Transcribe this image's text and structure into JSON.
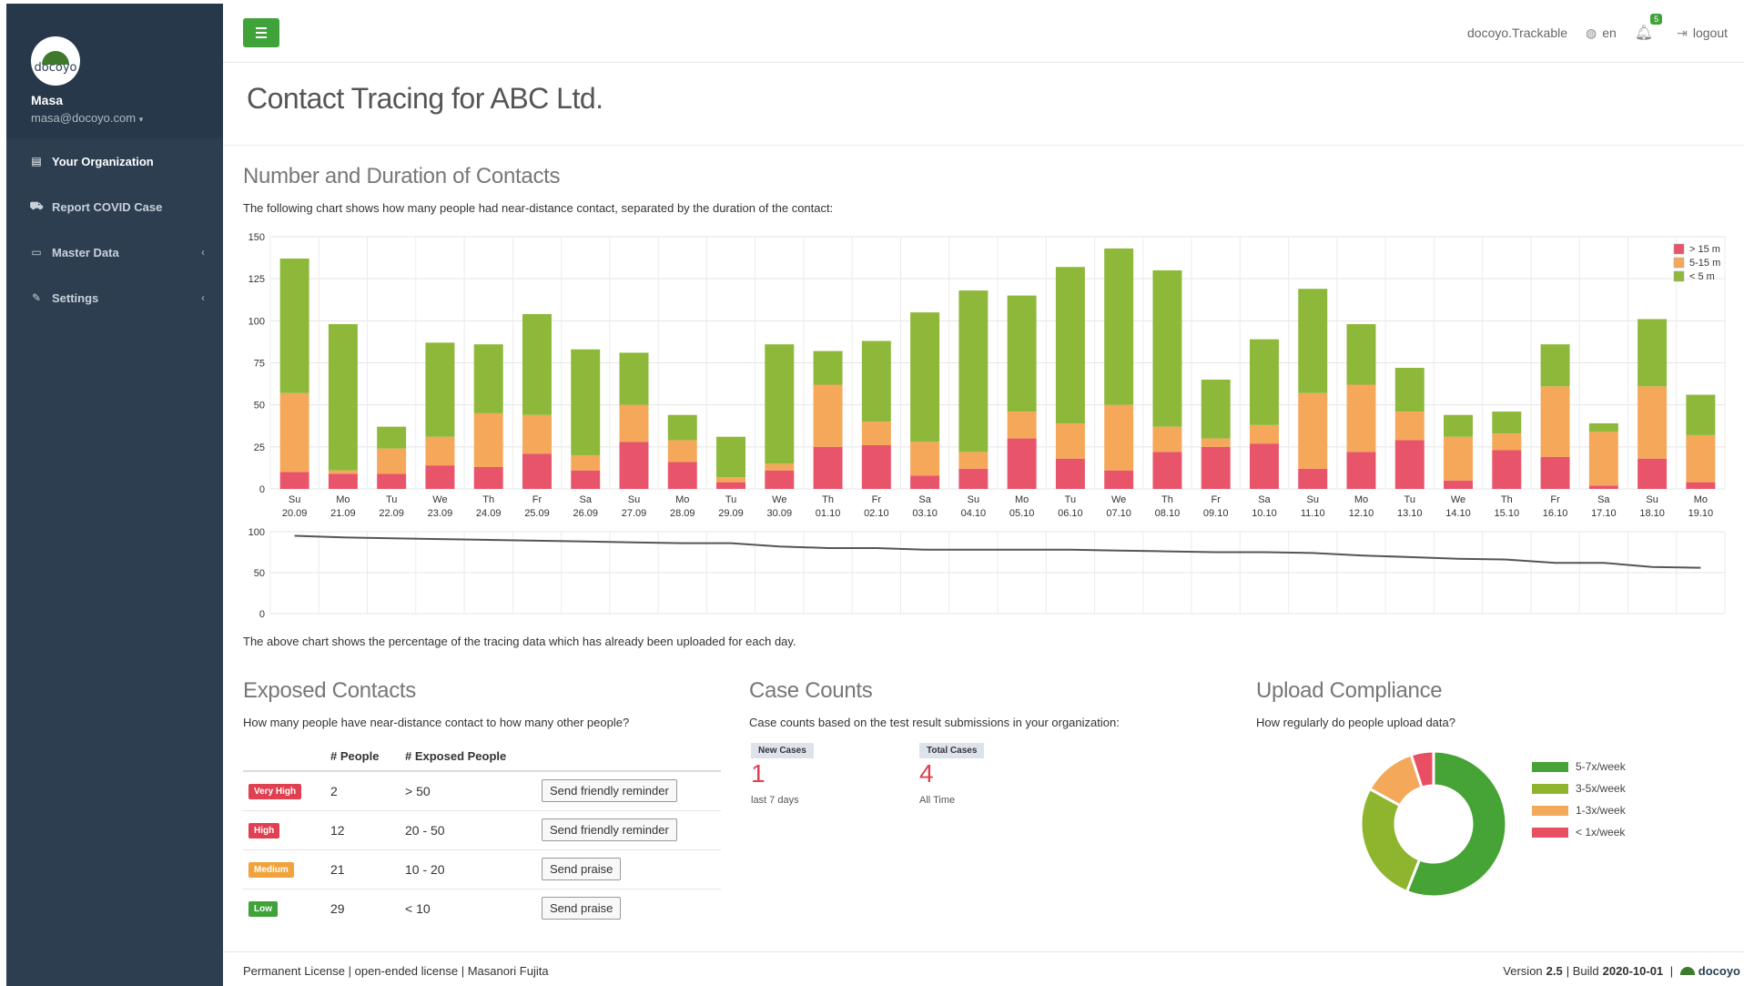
{
  "sidebar": {
    "logo_text": "docoyo",
    "user_name": "Masa",
    "user_email": "masa@docoyo.com",
    "items": [
      {
        "label": "Your Organization",
        "icon": "building-icon",
        "active": true
      },
      {
        "label": "Report COVID Case",
        "icon": "ambulance-icon"
      },
      {
        "label": "Master Data",
        "icon": "folder-icon",
        "has_submenu": true
      },
      {
        "label": "Settings",
        "icon": "wrench-icon",
        "has_submenu": true
      }
    ]
  },
  "topbar": {
    "app_name": "docoyo.Trackable",
    "language": "en",
    "notification_count": "5",
    "logout_label": "logout",
    "accent": "#3fa33a"
  },
  "page": {
    "title": "Contact Tracing for ABC Ltd."
  },
  "contacts": {
    "title": "Number and Duration of Contacts",
    "description": "The following chart shows how many people had near-distance contact, separated by the duration of the contact:",
    "upload_note": "The above chart shows the percentage of the tracing data which has already been uploaded for each day."
  },
  "chart_data": [
    {
      "type": "bar",
      "stacked": true,
      "categories": [
        "Su 20.09",
        "Mo 21.09",
        "Tu 22.09",
        "We 23.09",
        "Th 24.09",
        "Fr 25.09",
        "Sa 26.09",
        "Su 27.09",
        "Mo 28.09",
        "Tu 29.09",
        "We 30.09",
        "Th 01.10",
        "Fr 02.10",
        "Sa 03.10",
        "Su 04.10",
        "Mo 05.10",
        "Tu 06.10",
        "We 07.10",
        "Th 08.10",
        "Fr 09.10",
        "Sa 10.10",
        "Su 11.10",
        "Mo 12.10",
        "Tu 13.10",
        "We 14.10",
        "Th 15.10",
        "Fr 16.10",
        "Sa 17.10",
        "Su 18.10",
        "Mo 19.10"
      ],
      "series": [
        {
          "name": "> 15 m",
          "color": "#e8546a",
          "values": [
            10,
            9,
            9,
            14,
            13,
            21,
            11,
            28,
            16,
            4,
            11,
            25,
            26,
            8,
            12,
            30,
            18,
            11,
            22,
            25,
            27,
            12,
            22,
            29,
            5,
            23,
            19,
            2,
            18,
            4
          ]
        },
        {
          "name": "5-15 m",
          "color": "#f5a85a",
          "values": [
            47,
            2,
            15,
            17,
            32,
            23,
            9,
            22,
            13,
            3,
            4,
            37,
            14,
            20,
            10,
            16,
            21,
            39,
            15,
            5,
            11,
            45,
            40,
            17,
            26,
            10,
            42,
            32,
            43,
            28
          ]
        },
        {
          "name": "< 5 m",
          "color": "#8db83a",
          "values": [
            80,
            87,
            13,
            56,
            41,
            60,
            63,
            31,
            15,
            24,
            71,
            20,
            48,
            77,
            96,
            69,
            93,
            93,
            93,
            35,
            51,
            62,
            36,
            26,
            13,
            13,
            25,
            5,
            40,
            24
          ]
        }
      ],
      "ylim": [
        0,
        150
      ],
      "yticks": [
        0,
        25,
        50,
        75,
        100,
        125,
        150
      ],
      "legend": "top-right",
      "grid": true
    },
    {
      "type": "line",
      "x": [
        "20.09",
        "21.09",
        "22.09",
        "23.09",
        "24.09",
        "25.09",
        "26.09",
        "27.09",
        "28.09",
        "29.09",
        "30.09",
        "01.10",
        "02.10",
        "03.10",
        "04.10",
        "05.10",
        "06.10",
        "07.10",
        "08.10",
        "09.10",
        "10.10",
        "11.10",
        "12.10",
        "13.10",
        "14.10",
        "15.10",
        "16.10",
        "17.10",
        "18.10",
        "19.10"
      ],
      "series": [
        {
          "color": "#555555",
          "values": [
            95,
            93,
            92,
            91,
            90,
            89,
            88,
            87,
            86,
            86,
            82,
            80,
            80,
            78,
            78,
            78,
            78,
            77,
            76,
            75,
            75,
            74,
            71,
            69,
            67,
            66,
            62,
            62,
            57,
            56
          ]
        }
      ],
      "ylim": [
        0,
        100
      ],
      "yticks": [
        0,
        50,
        100
      ],
      "grid": true
    },
    {
      "type": "pie",
      "donut": true,
      "categories": [
        "5-7x/week",
        "3-5x/week",
        "1-3x/week",
        "< 1x/week"
      ],
      "values": [
        56,
        27,
        12,
        5
      ],
      "colors": [
        "#46a335",
        "#8fb52e",
        "#f4a85a",
        "#e84f63"
      ],
      "legend": "right"
    }
  ],
  "exposed": {
    "title": "Exposed Contacts",
    "description": "How many people have near-distance contact to how many other people?",
    "col_people": "# People",
    "col_exposed": "# Exposed People",
    "rows": [
      {
        "level": "Very High",
        "color": "#e0404f",
        "people": "2",
        "exposed": "> 50",
        "action": "Send friendly reminder"
      },
      {
        "level": "High",
        "color": "#e0404f",
        "people": "12",
        "exposed": "20 - 50",
        "action": "Send friendly reminder"
      },
      {
        "level": "Medium",
        "color": "#f0a23c",
        "people": "21",
        "exposed": "10 - 20",
        "action": "Send praise"
      },
      {
        "level": "Low",
        "color": "#3fa33a",
        "people": "29",
        "exposed": "< 10",
        "action": "Send praise"
      }
    ]
  },
  "cases": {
    "title": "Case Counts",
    "description": "Case counts based on the test result submissions in your organization:",
    "new_label": "New Cases",
    "new_value": "1",
    "new_sub": "last 7 days",
    "total_label": "Total Cases",
    "total_value": "4",
    "total_sub": "All Time"
  },
  "compliance": {
    "title": "Upload Compliance",
    "description": "How regularly do people upload data?"
  },
  "footer": {
    "license": "Permanent License | open-ended license | Masanori Fujita",
    "version_prefix": "Version ",
    "version": "2.5",
    "build_prefix": " | Build ",
    "build": "2020-10-01",
    "brand": "docoyo"
  }
}
